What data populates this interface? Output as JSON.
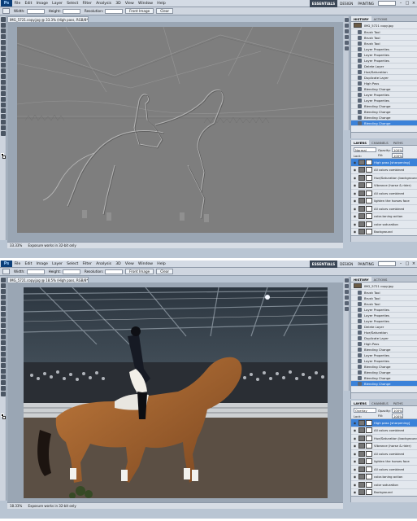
{
  "app": {
    "logo": "Ps",
    "menu": [
      "File",
      "Edit",
      "Image",
      "Layer",
      "Select",
      "Filter",
      "Analysis",
      "3D",
      "View",
      "Window",
      "Help"
    ],
    "workspaces": [
      "ESSENTIALS",
      "DESIGN",
      "PAINTING"
    ],
    "active_workspace": "ESSENTIALS",
    "window_controls": [
      "–",
      "□",
      "×"
    ]
  },
  "options": {
    "width_label": "Width:",
    "height_label": "Height:",
    "resolution_label": "Resolution:",
    "front_image": "Front Image",
    "clear": "Clear"
  },
  "panels": {
    "history_tabs": [
      "HISTORY",
      "ACTIONS"
    ],
    "layers_tabs": [
      "LAYERS",
      "CHANNELS",
      "PATHS"
    ]
  },
  "top": {
    "doc_tab": "IMG_5721.copy.jpg @ 33.3% (High pass, RGB/8*)",
    "status_zoom": "33.33%",
    "status_doc": "Exposure works in 32-bit only",
    "history": {
      "snapshot": "IMG_5721 copy.jpg",
      "items": [
        "Brush Tool",
        "Brush Tool",
        "Brush Tool",
        "Layer Properties",
        "Layer Properties",
        "Layer Properties",
        "Delete Layer",
        "Hue/Saturation",
        "Duplicate Layer",
        "High Pass",
        "Blending Change",
        "Layer Properties",
        "Layer Properties",
        "Blending Change",
        "Blending Change",
        "Blending Change",
        "Blending Change"
      ],
      "selected": 16
    },
    "layers": {
      "blend_mode": "Normal",
      "opacity_label": "Opacity:",
      "opacity": "100%",
      "lock_label": "Lock:",
      "fill_label": "Fill:",
      "fill": "100%",
      "items": [
        "High pass [sharpening]",
        "All colors combined",
        "Hue/Saturation (background)",
        "Vibrance (horse & rider)",
        "All colors combined",
        "lighten the horses face",
        "All colors combined",
        "color-toning action",
        "color saturation",
        "Background"
      ],
      "selected": 0
    }
  },
  "bottom": {
    "doc_tab": "IMG_5721.copy.jpg @ 18.5% (High pass, RGB/8*)",
    "status_zoom": "18.33%",
    "status_doc": "Exposure works in 32-bit only",
    "history": {
      "snapshot": "IMG_5721 copy.jpg",
      "items": [
        "Brush Tool",
        "Brush Tool",
        "Brush Tool",
        "Layer Properties",
        "Layer Properties",
        "Layer Properties",
        "Delete Layer",
        "Hue/Saturation",
        "Duplicate Layer",
        "High Pass",
        "Blending Change",
        "Layer Properties",
        "Layer Properties",
        "Blending Change",
        "Blending Change",
        "Blending Change",
        "Blending Change"
      ],
      "selected": 16
    },
    "layers": {
      "blend_mode": "Overlay",
      "opacity_label": "Opacity:",
      "opacity": "100%",
      "lock_label": "Lock:",
      "fill_label": "Fill:",
      "fill": "100%",
      "items": [
        "High pass [sharpening]",
        "All colors combined",
        "Hue/Saturation (background)",
        "Vibrance (horse & rider)",
        "All colors combined",
        "lighten the horses face",
        "All colors combined",
        "color-toning action",
        "color saturation",
        "Background"
      ],
      "selected": 0
    }
  },
  "colors": {
    "selection": "#3b82d9",
    "ui_chrome": "#b9c5d3",
    "highpass_gray": "#7d7d7d"
  }
}
